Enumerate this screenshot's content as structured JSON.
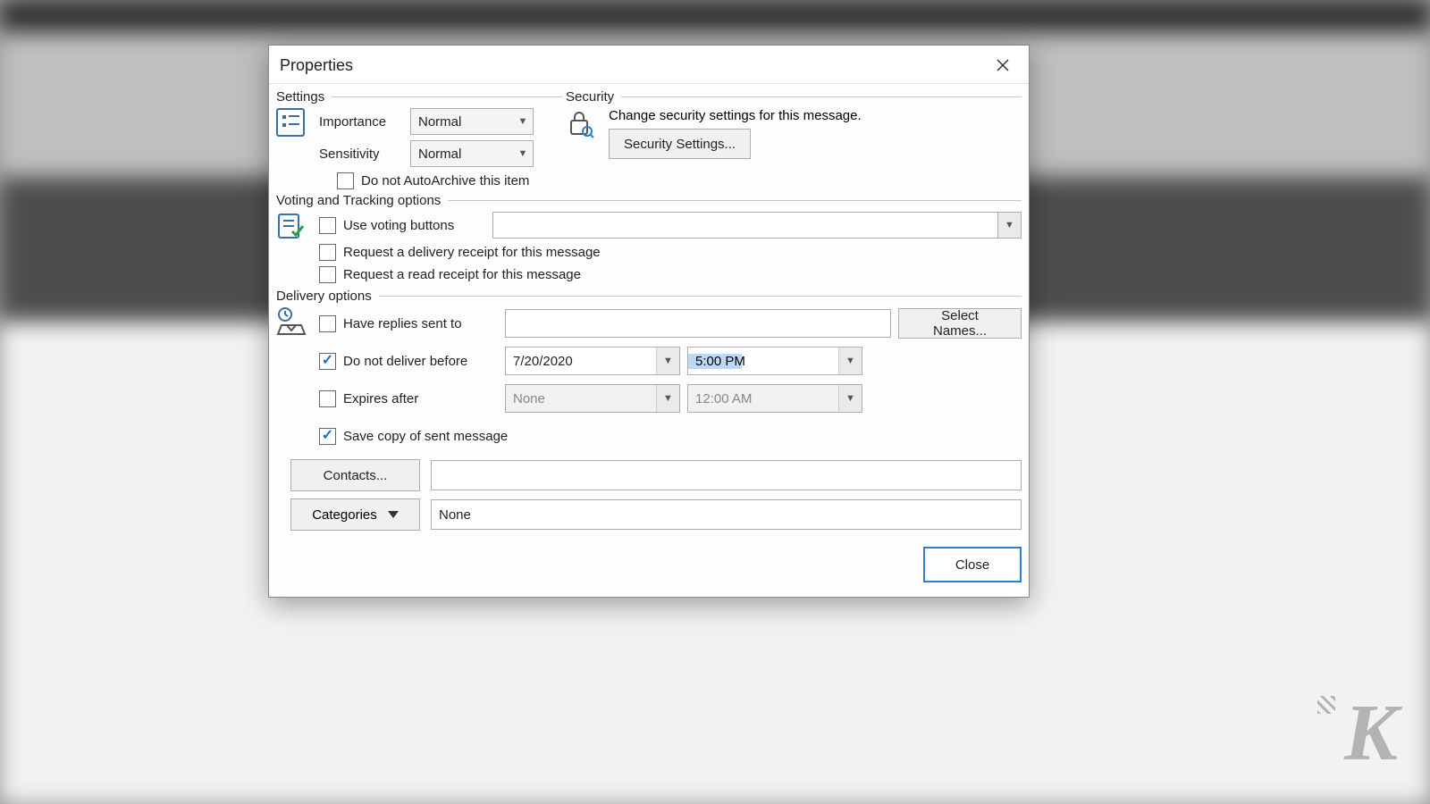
{
  "dialog": {
    "title": "Properties",
    "close_label": "Close"
  },
  "settings": {
    "legend": "Settings",
    "importance_label": "Importance",
    "importance_value": "Normal",
    "sensitivity_label": "Sensitivity",
    "sensitivity_value": "Normal",
    "autoarchive_label": "Do not AutoArchive this item",
    "autoarchive_checked": false
  },
  "security": {
    "legend": "Security",
    "description": "Change security settings for this message.",
    "button_label": "Security Settings..."
  },
  "voting": {
    "legend": "Voting and Tracking options",
    "use_voting_label": "Use voting buttons",
    "use_voting_checked": false,
    "voting_value": "",
    "delivery_receipt_label": "Request a delivery receipt for this message",
    "delivery_receipt_checked": false,
    "read_receipt_label": "Request a read receipt for this message",
    "read_receipt_checked": false
  },
  "delivery": {
    "legend": "Delivery options",
    "have_replies_label": "Have replies sent to",
    "have_replies_checked": false,
    "have_replies_value": "",
    "select_names_label": "Select Names...",
    "no_deliver_before_label": "Do not deliver before",
    "no_deliver_before_checked": true,
    "no_deliver_before_date": "7/20/2020",
    "no_deliver_before_time": "5:00 PM",
    "expires_after_label": "Expires after",
    "expires_after_checked": false,
    "expires_after_date": "None",
    "expires_after_time": "12:00 AM",
    "save_copy_label": "Save copy of sent message",
    "save_copy_checked": true,
    "contacts_button": "Contacts...",
    "contacts_value": "",
    "categories_button": "Categories",
    "categories_value": "None"
  },
  "watermark": "K"
}
